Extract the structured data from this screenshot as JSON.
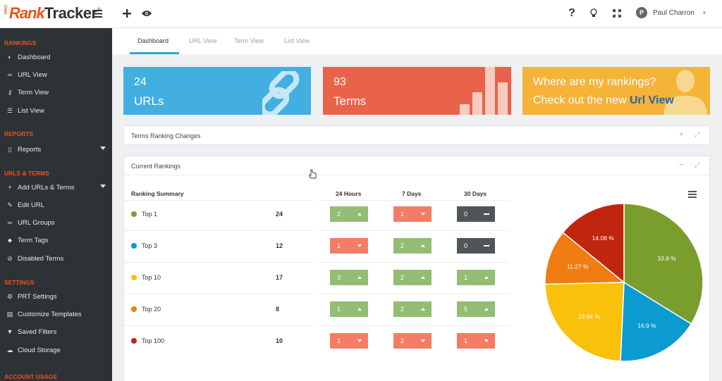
{
  "app": {
    "logo_pro": "PRO",
    "logo_rank": "Rank",
    "logo_tracker": "Tracker",
    "logo_reg": "®"
  },
  "topbar": {
    "menu_icon": "hamburger-icon",
    "add_icon": "plus-icon",
    "eye_icon": "eye-icon",
    "help": "?",
    "bulb_icon": "lightbulb-icon",
    "fullscreen_icon": "expand-icon",
    "user_initial": "P",
    "user_name": "Paul Charron"
  },
  "sidebar": {
    "sections": [
      {
        "title": "RANKINGS",
        "items": [
          {
            "label": "Dashboard",
            "icon": "palette-icon"
          },
          {
            "label": "URL View",
            "icon": "link-icon"
          },
          {
            "label": "Term View",
            "icon": "key-icon"
          },
          {
            "label": "List View",
            "icon": "list-icon"
          }
        ]
      },
      {
        "title": "REPORTS",
        "items": [
          {
            "label": "Reports",
            "icon": "file-icon",
            "dropdown": true
          }
        ]
      },
      {
        "title": "URLS & TERMS",
        "items": [
          {
            "label": "Add URLs & Terms",
            "icon": "plus-icon",
            "dropdown": true
          },
          {
            "label": "Edit URL",
            "icon": "edit-icon"
          },
          {
            "label": "URL Groups",
            "icon": "link-icon"
          },
          {
            "label": "Term Tags",
            "icon": "tag-icon"
          },
          {
            "label": "Disabled Terms",
            "icon": "ban-icon"
          }
        ]
      },
      {
        "title": "SETTINGS",
        "items": [
          {
            "label": "PRT Settings",
            "icon": "gear-icon"
          },
          {
            "label": "Customize Templates",
            "icon": "template-icon"
          },
          {
            "label": "Saved Filters",
            "icon": "filter-icon"
          },
          {
            "label": "Cloud Storage",
            "icon": "cloud-icon"
          }
        ]
      },
      {
        "title": "ACCOUNT USAGE",
        "items": []
      }
    ]
  },
  "tabs": [
    "Dashboard",
    "URL View",
    "Term View",
    "List View"
  ],
  "cards": {
    "urls": {
      "count": "24",
      "label": "URLs"
    },
    "terms": {
      "count": "93",
      "label": "Terms"
    },
    "promo": {
      "line1": "Where are my rankings?",
      "line2_prefix": "Check out the new ",
      "line2_link": "Url View"
    }
  },
  "panels": {
    "changes": {
      "title": "Terms Ranking Changes"
    },
    "current": {
      "title": "Current Rankings"
    }
  },
  "rankings": {
    "header": "Ranking Summary",
    "period_headers": [
      "24 Hours",
      "7 Days",
      "30 Days"
    ],
    "rows": [
      {
        "label": "Top 1",
        "count": "24",
        "color": "#7a9e2d",
        "changes": [
          {
            "value": "2",
            "dir": "up"
          },
          {
            "value": "1",
            "dir": "down"
          },
          {
            "value": "0",
            "dir": "flat"
          }
        ]
      },
      {
        "label": "Top 3",
        "count": "12",
        "color": "#0b9bd1",
        "changes": [
          {
            "value": "1",
            "dir": "down"
          },
          {
            "value": "2",
            "dir": "up"
          },
          {
            "value": "0",
            "dir": "flat"
          }
        ]
      },
      {
        "label": "Top 10",
        "count": "17",
        "color": "#f9c00c",
        "changes": [
          {
            "value": "3",
            "dir": "up"
          },
          {
            "value": "2",
            "dir": "up"
          },
          {
            "value": "1",
            "dir": "up"
          }
        ]
      },
      {
        "label": "Top 20",
        "count": "8",
        "color": "#ef7d11",
        "changes": [
          {
            "value": "1",
            "dir": "up"
          },
          {
            "value": "2",
            "dir": "up"
          },
          {
            "value": "5",
            "dir": "up"
          }
        ]
      },
      {
        "label": "Top 100",
        "count": "10",
        "color": "#c0260e",
        "changes": [
          {
            "value": "1",
            "dir": "down"
          },
          {
            "value": "2",
            "dir": "down"
          },
          {
            "value": "1",
            "dir": "down"
          }
        ]
      }
    ]
  },
  "chart_data": {
    "type": "pie",
    "slices": [
      {
        "label": "33.8 %",
        "value": 33.8,
        "color": "#7a9e2d"
      },
      {
        "label": "16.9 %",
        "value": 16.9,
        "color": "#0b9bd1"
      },
      {
        "label": "23.94 %",
        "value": 23.94,
        "color": "#f9c00c"
      },
      {
        "label": "11.27 %",
        "value": 11.27,
        "color": "#ef7d11"
      },
      {
        "label": "14.08 %",
        "value": 14.08,
        "color": "#c0260e"
      }
    ]
  },
  "colors": {
    "accent": "#e8541c",
    "sidebar_bg": "#2d3237",
    "card_blue": "#42afe0",
    "card_red": "#e9634b",
    "card_yellow": "#f5b338",
    "change_up": "#93bd73",
    "change_down": "#f47c66",
    "change_flat": "#505558"
  }
}
